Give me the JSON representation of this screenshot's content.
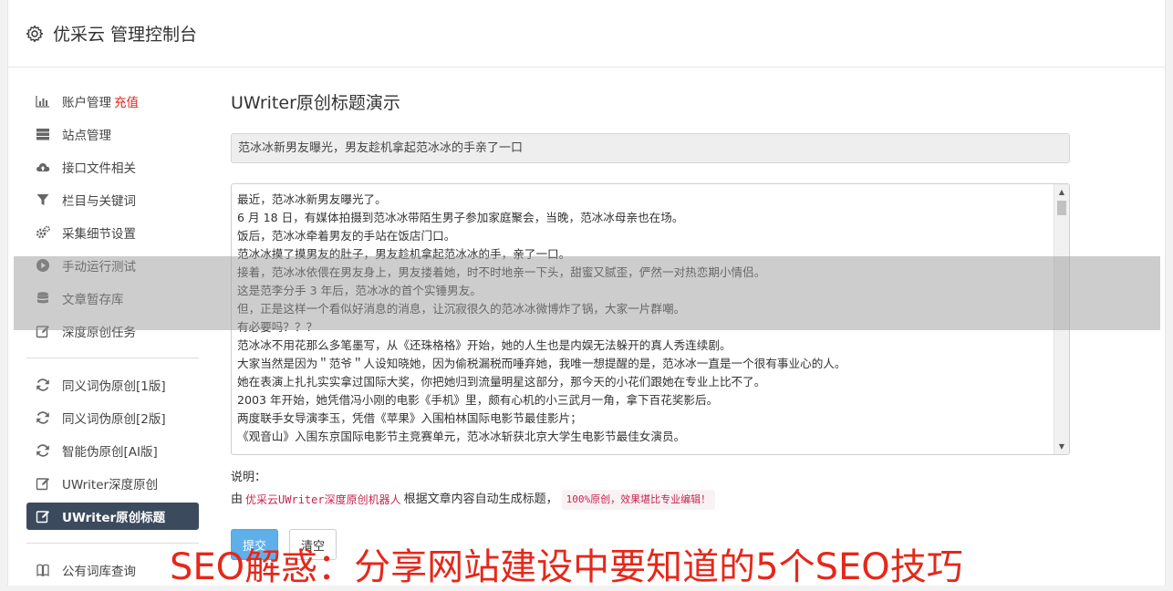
{
  "header": {
    "title": "优采云 管理控制台"
  },
  "sidebar": {
    "group1": [
      {
        "label": "账户管理",
        "badge": "充值",
        "icon": "bar-chart-icon"
      },
      {
        "label": "站点管理",
        "icon": "server-icon"
      },
      {
        "label": "接口文件相关",
        "icon": "cloud-upload-icon"
      },
      {
        "label": "栏目与关键词",
        "icon": "filter-icon"
      },
      {
        "label": "采集细节设置",
        "icon": "gears-icon"
      },
      {
        "label": "手动运行测试",
        "icon": "play-circle-icon"
      },
      {
        "label": "文章暂存库",
        "icon": "database-icon"
      },
      {
        "label": "深度原创任务",
        "icon": "edit-icon"
      }
    ],
    "group2": [
      {
        "label": "同义词伪原创[1版]",
        "icon": "refresh-icon"
      },
      {
        "label": "同义词伪原创[2版]",
        "icon": "refresh-icon"
      },
      {
        "label": "智能伪原创[AI版]",
        "icon": "refresh-icon"
      },
      {
        "label": "UWriter深度原创",
        "icon": "edit-icon"
      },
      {
        "label": "UWriter原创标题",
        "icon": "edit-icon",
        "active": true
      }
    ],
    "group3": [
      {
        "label": "公有词库查询",
        "icon": "book-icon"
      }
    ]
  },
  "main": {
    "title": "UWriter原创标题演示",
    "generated_title": "范冰冰新男友曝光，男友趁机拿起范冰冰的手亲了一口",
    "article_lines": [
      "最近，范冰冰新男友曝光了。",
      "6 月 18 日，有媒体拍摄到范冰冰带陌生男子参加家庭聚会，当晚，范冰冰母亲也在场。",
      "饭后，范冰冰牵着男友的手站在饭店门口。",
      "范冰冰摸了摸男友的肚子，男友趁机拿起范冰冰的手，亲了一口。",
      "接着，范冰冰依偎在男友身上，男友搂着她，时不时地亲一下头，甜蜜又腻歪，俨然一对热恋期小情侣。",
      "这是范李分手 3 年后，范冰冰的首个实锤男友。",
      "但，正是这样一个看似好消息的消息，让沉寂很久的范冰冰微博炸了锅，大家一片群嘲。",
      "有必要吗？？？",
      "范冰冰不用花那么多笔墨写，从《还珠格格》开始，她的人生也是内娱无法躲开的真人秀连续剧。",
      "大家当然是因为＂范爷＂人设知晓她，因为偷税漏税而唾弃她，我唯一想提醒的是，范冰冰一直是一个很有事业心的人。",
      "她在表演上扎扎实实拿过国际大奖，你把她归到流量明星这部分，那今天的小花们跟她在专业上比不了。",
      "2003 年开始，她凭借冯小刚的电影《手机》里，颇有心机的小三武月一角，拿下百花奖影后。",
      "两度联手女导演李玉，凭借《苹果》入围柏林国际电影节最佳影片；",
      "《观音山》入围东京国际电影节主竞赛单元，范冰冰斩获北京大学生电影节最佳女演员。"
    ],
    "notes_label": "说明：",
    "notes_prefix": "由",
    "notes_link": "优采云UWriter深度原创机器人",
    "notes_middle": "根据文章内容自动生成标题，",
    "notes_code": "100%原创，效果堪比专业编辑！",
    "submit_label": "提交",
    "clear_label": "清空"
  },
  "watermark": "SEO解惑：分享网站建设中要知道的5个SEO技巧"
}
